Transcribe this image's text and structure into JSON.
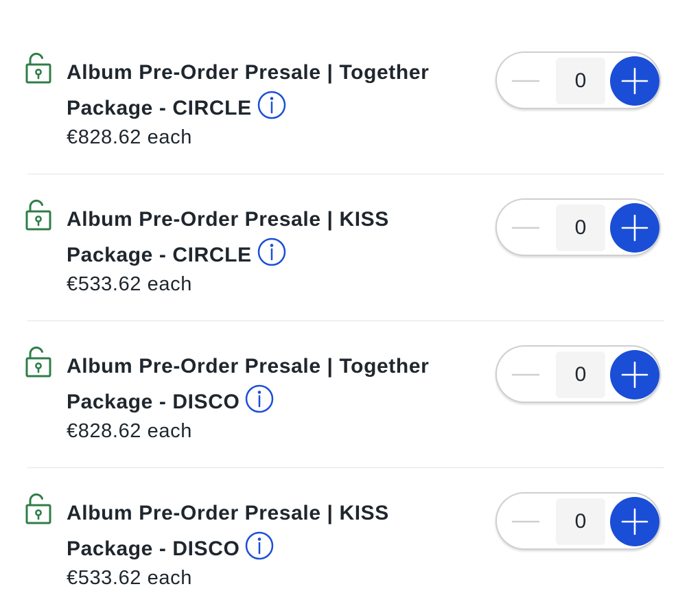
{
  "colors": {
    "accent": "#1b4ed7",
    "lock_icon": "#2e7d46",
    "text": "#1f262d",
    "divider": "#e3e3e3"
  },
  "icons": {
    "lock": "unlocked-padlock-icon",
    "info": "info-circle-icon",
    "minus": "minus-icon",
    "plus": "plus-icon"
  },
  "tickets": [
    {
      "name_line1": "Album Pre-Order Presale | Together",
      "name_line2": "Package - CIRCLE",
      "price": "€828.62 each",
      "quantity": "0"
    },
    {
      "name_line1": "Album Pre-Order Presale | KISS",
      "name_line2": "Package - CIRCLE",
      "price": "€533.62 each",
      "quantity": "0"
    },
    {
      "name_line1": "Album Pre-Order Presale | Together",
      "name_line2": "Package - DISCO",
      "price": "€828.62 each",
      "quantity": "0"
    },
    {
      "name_line1": "Album Pre-Order Presale | KISS",
      "name_line2": "Package - DISCO",
      "price": "€533.62 each",
      "quantity": "0"
    }
  ]
}
